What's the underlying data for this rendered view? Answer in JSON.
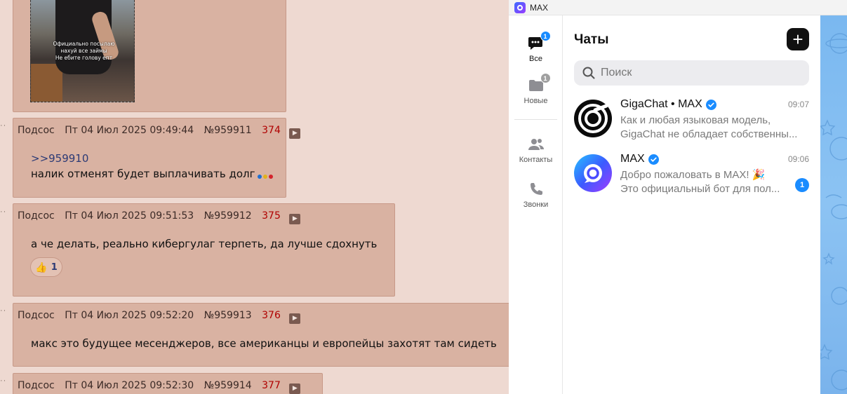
{
  "board": {
    "image_caption": [
      "Официально посылаю",
      "нахуй все займы",
      "Не ебите голову епт"
    ],
    "posts": [
      {
        "author": "Подсос",
        "date": "Пт 04 Июл 2025 09:49:44",
        "number": "№959911",
        "index": "374",
        "reply_link": ">>959910",
        "lines": [
          "налик отменят будет выплачивать долг"
        ]
      },
      {
        "author": "Подсос",
        "date": "Пт 04 Июл 2025 09:51:53",
        "number": "№959912",
        "index": "375",
        "lines": [
          "а че делать, реально кибергулаг терпеть, да лучше сдохнуть"
        ],
        "reaction": {
          "emoji": "👍",
          "count": "1"
        }
      },
      {
        "author": "Подсос",
        "date": "Пт 04 Июл 2025 09:52:20",
        "number": "№959913",
        "index": "376",
        "lines": [
          "макс это будущее месенджеров, все американцы и европейцы захотят там сидеть"
        ]
      },
      {
        "author": "Подсос",
        "date": "Пт 04 Июл 2025 09:52:30",
        "number": "№959914",
        "index": "377"
      }
    ],
    "colors": {
      "post_bg": "#d9b2a2",
      "page_bg": "#eed9d1",
      "post_index": "#b00000"
    }
  },
  "max": {
    "window_title": "MAX",
    "nav": {
      "all": {
        "label": "Все",
        "badge": "1"
      },
      "new": {
        "label": "Новые",
        "badge": "1"
      },
      "contacts": {
        "label": "Контакты"
      },
      "calls": {
        "label": "Звонки"
      }
    },
    "header": {
      "title": "Чаты",
      "new_button": "+"
    },
    "search": {
      "placeholder": "Поиск"
    },
    "chats": [
      {
        "name": "GigaChat • MAX",
        "time": "09:07",
        "preview_line1": "Как и любая языковая модель,",
        "preview_line2": "GigaChat не обладает собственны..."
      },
      {
        "name": "MAX",
        "time": "09:06",
        "preview_line1": "Добро пожаловать в MAX! 🎉",
        "preview_line2": "Это официальный бот для пол...",
        "unread": "1"
      }
    ],
    "colors": {
      "accent": "#1a8cff",
      "wallpaper": "#7ab8f0"
    }
  }
}
